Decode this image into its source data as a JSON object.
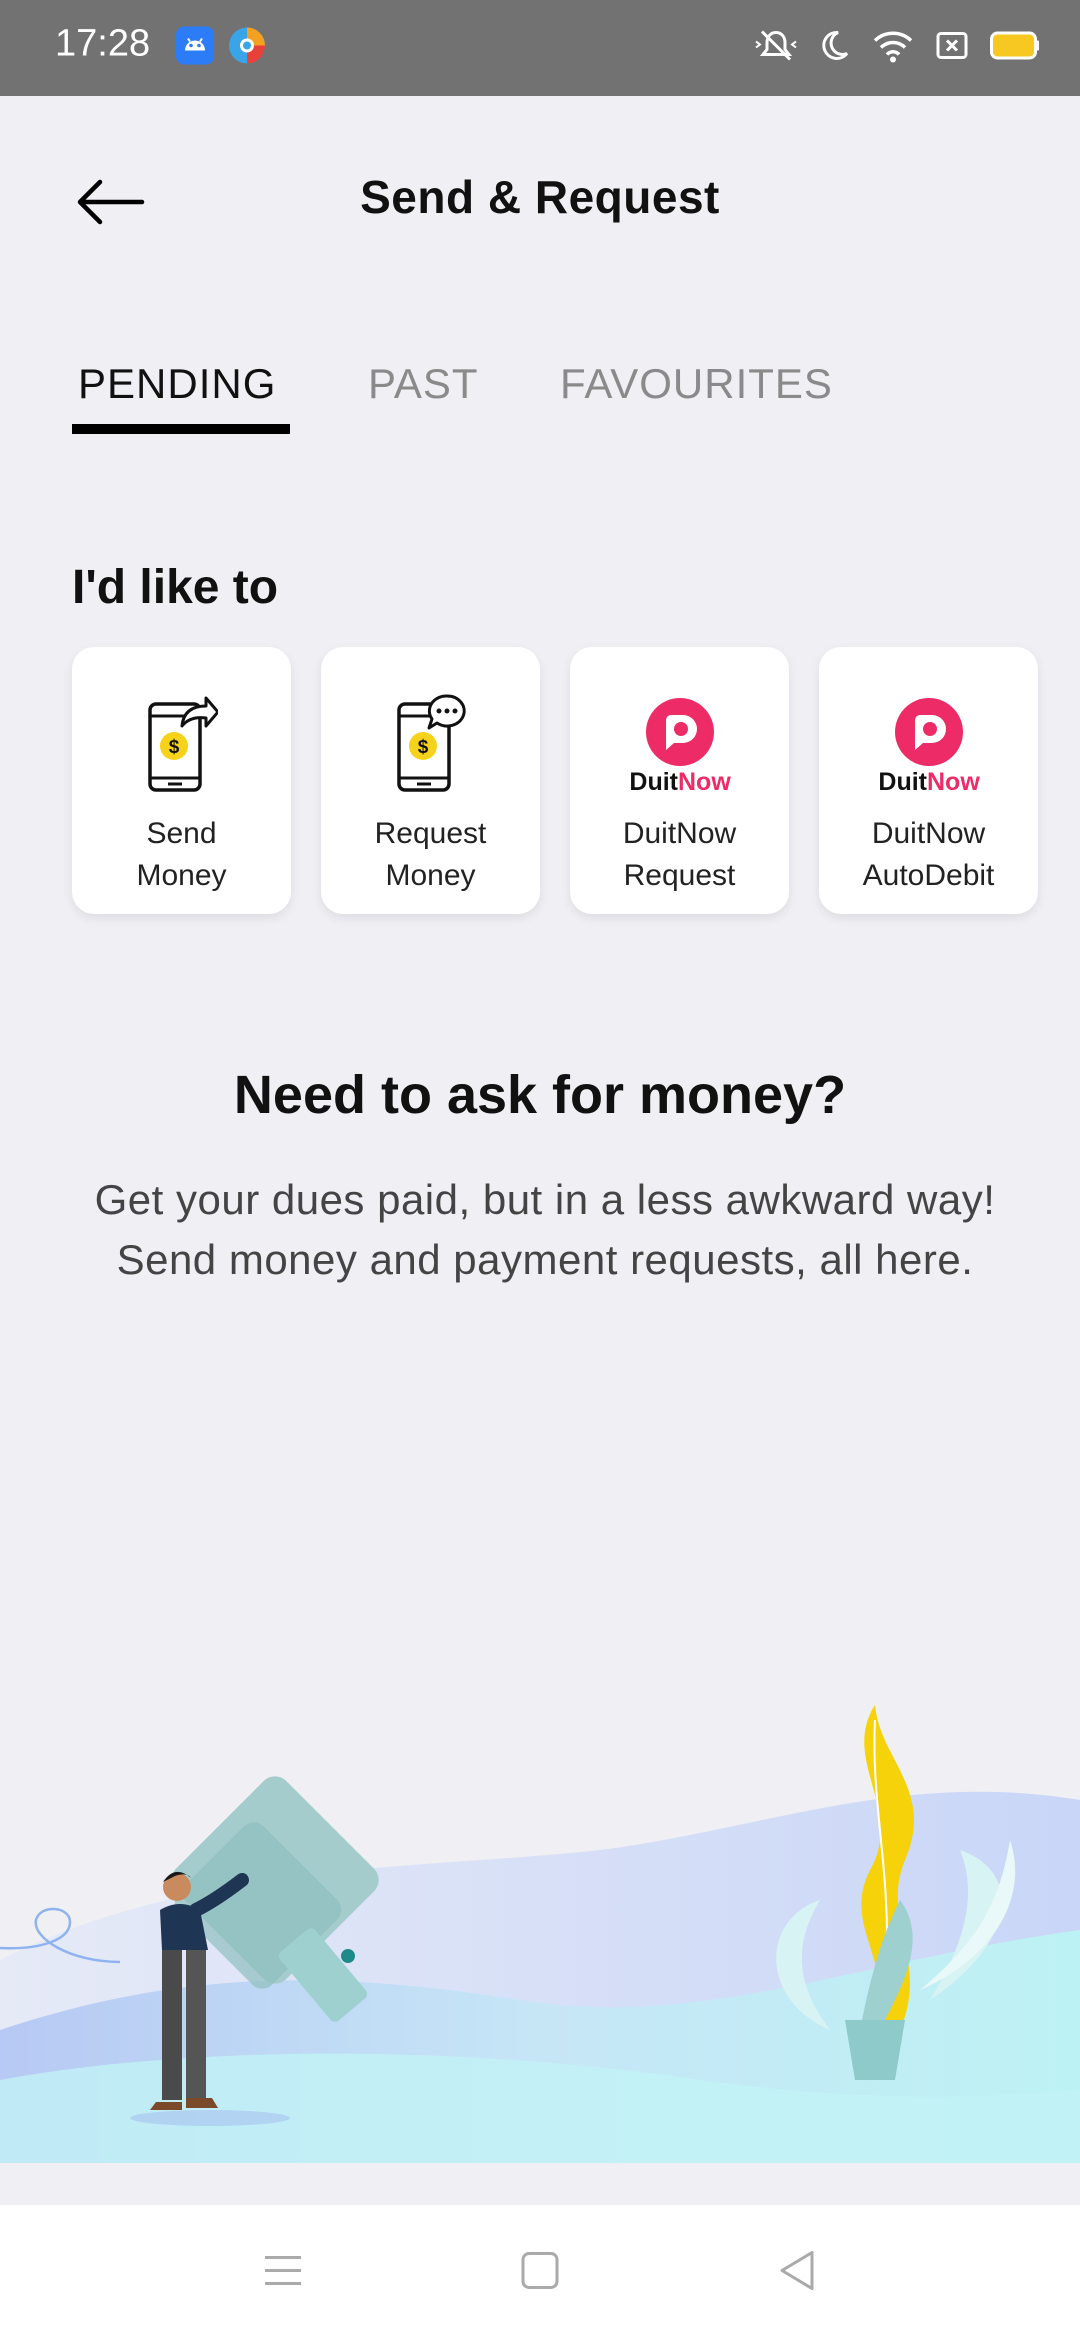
{
  "status_bar": {
    "time": "17:28",
    "icons": [
      "android-app-icon",
      "browser-app-icon",
      "mute-icon",
      "do-not-disturb-icon",
      "wifi-icon",
      "sim-icon",
      "battery-icon"
    ]
  },
  "header": {
    "title": "Send & Request",
    "back_icon": "arrow-left-icon"
  },
  "tabs": [
    {
      "label": "PENDING",
      "active": true
    },
    {
      "label": "PAST",
      "active": false
    },
    {
      "label": "FAVOURITES",
      "active": false
    }
  ],
  "section": {
    "title": "I'd like to"
  },
  "actions": [
    {
      "label": "Send\nMoney",
      "icon": "phone-send-money-icon"
    },
    {
      "label": "Request\nMoney",
      "icon": "phone-request-money-icon"
    },
    {
      "label": "DuitNow\nRequest",
      "icon": "duitnow-logo-icon"
    },
    {
      "label": "DuitNow\nAutoDebit",
      "icon": "duitnow-logo-icon"
    }
  ],
  "duitnow_logo": {
    "word1": "Duit",
    "word2": "Now"
  },
  "promo": {
    "title": "Need to ask for money?",
    "line1": "Get your dues paid, but in a less awkward way!",
    "line2": "Send money and payment requests, all here."
  },
  "colors": {
    "duitnow_pink": "#ed2c67",
    "coin_yellow": "#f7d21a",
    "tab_active": "#000000",
    "status_bar": "#727272"
  },
  "nav_bar": {
    "icons": [
      "menu-icon",
      "home-square-icon",
      "back-triangle-icon"
    ]
  }
}
